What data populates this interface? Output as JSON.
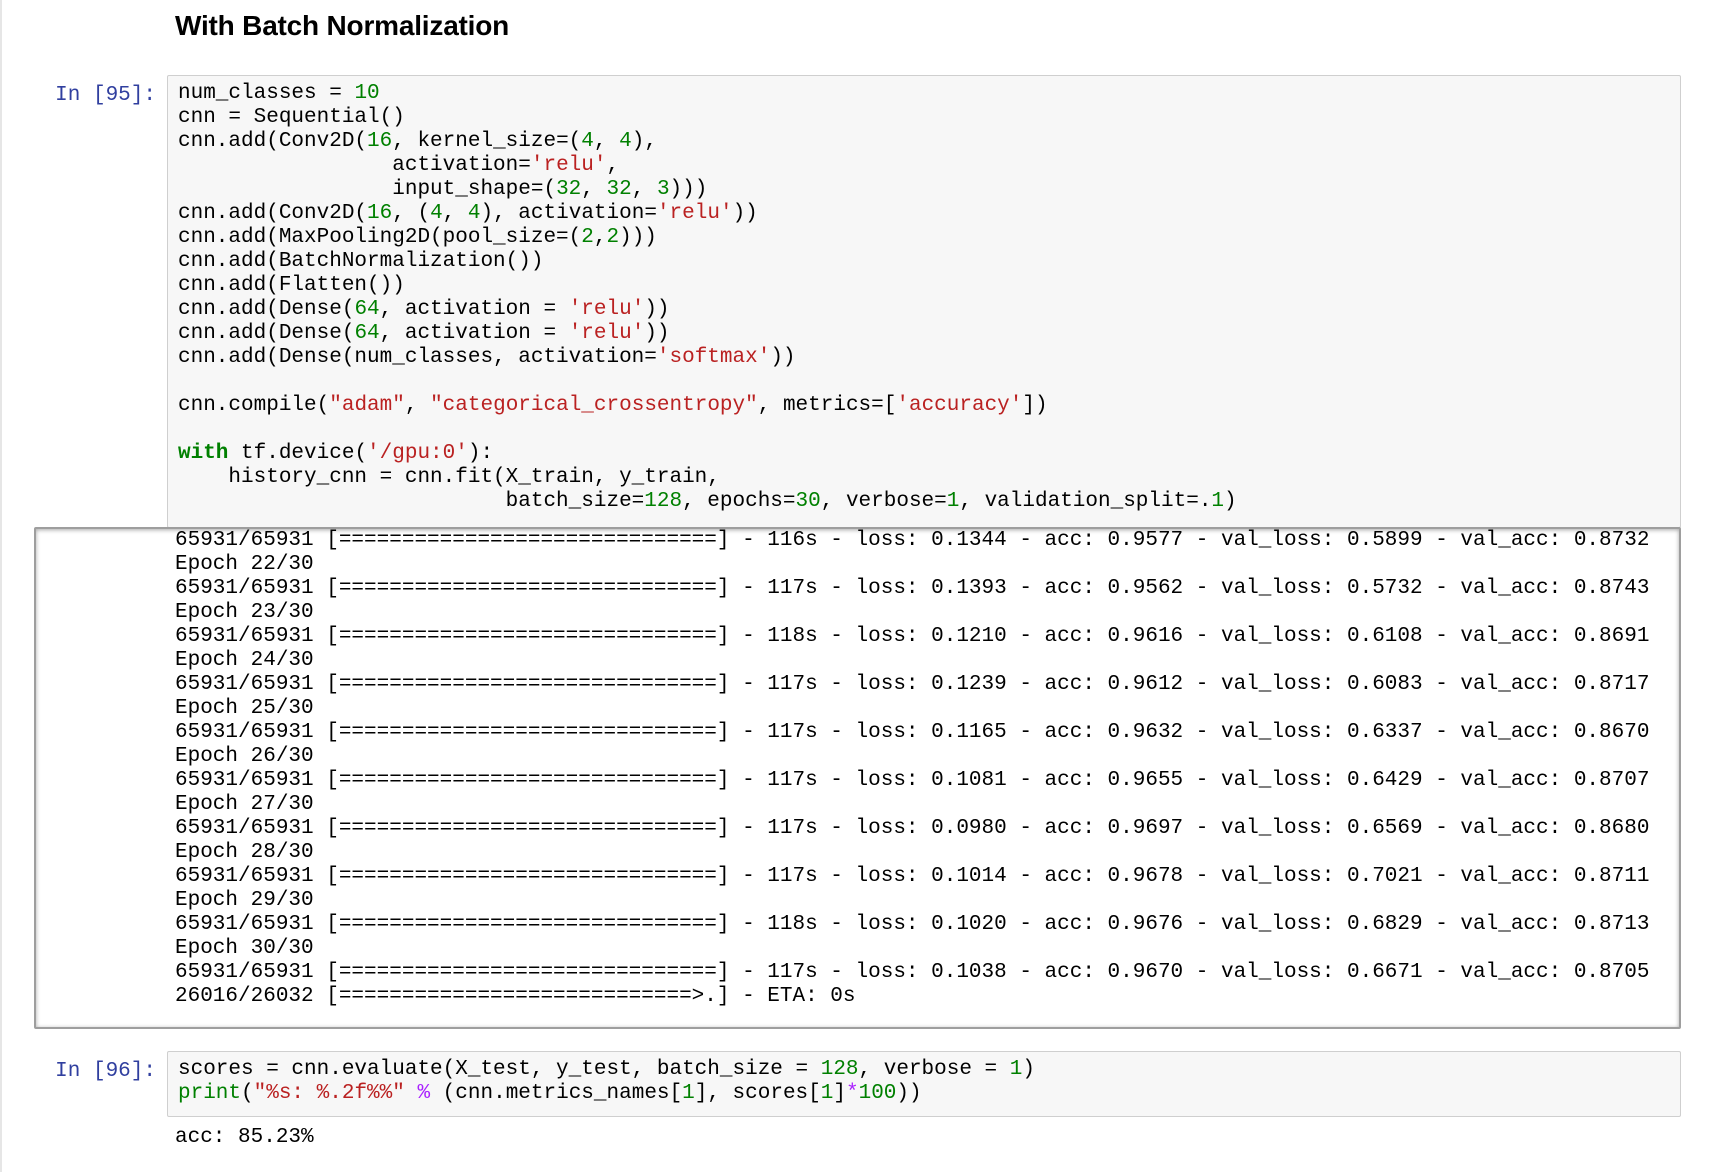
{
  "heading": "With Batch Normalization",
  "cell95": {
    "prompt": "In [95]:",
    "lines": [
      [
        [
          "t",
          "num_classes = "
        ],
        [
          "num",
          "10"
        ]
      ],
      [
        [
          "t",
          "cnn = Sequential()"
        ]
      ],
      [
        [
          "t",
          "cnn.add(Conv2D("
        ],
        [
          "num",
          "16"
        ],
        [
          "t",
          ", kernel_size=("
        ],
        [
          "num",
          "4"
        ],
        [
          "t",
          ", "
        ],
        [
          "num",
          "4"
        ],
        [
          "t",
          "),"
        ]
      ],
      [
        [
          "t",
          "                 activation="
        ],
        [
          "str",
          "'relu'"
        ],
        [
          "t",
          ","
        ]
      ],
      [
        [
          "t",
          "                 input_shape=("
        ],
        [
          "num",
          "32"
        ],
        [
          "t",
          ", "
        ],
        [
          "num",
          "32"
        ],
        [
          "t",
          ", "
        ],
        [
          "num",
          "3"
        ],
        [
          "t",
          ")))"
        ]
      ],
      [
        [
          "t",
          "cnn.add(Conv2D("
        ],
        [
          "num",
          "16"
        ],
        [
          "t",
          ", ("
        ],
        [
          "num",
          "4"
        ],
        [
          "t",
          ", "
        ],
        [
          "num",
          "4"
        ],
        [
          "t",
          "), activation="
        ],
        [
          "str",
          "'relu'"
        ],
        [
          "t",
          "))"
        ]
      ],
      [
        [
          "t",
          "cnn.add(MaxPooling2D(pool_size=("
        ],
        [
          "num",
          "2"
        ],
        [
          "t",
          ","
        ],
        [
          "num",
          "2"
        ],
        [
          "t",
          ")))"
        ]
      ],
      [
        [
          "t",
          "cnn.add(BatchNormalization())"
        ]
      ],
      [
        [
          "t",
          "cnn.add(Flatten())"
        ]
      ],
      [
        [
          "t",
          "cnn.add(Dense("
        ],
        [
          "num",
          "64"
        ],
        [
          "t",
          ", activation = "
        ],
        [
          "str",
          "'relu'"
        ],
        [
          "t",
          "))"
        ]
      ],
      [
        [
          "t",
          "cnn.add(Dense("
        ],
        [
          "num",
          "64"
        ],
        [
          "t",
          ", activation = "
        ],
        [
          "str",
          "'relu'"
        ],
        [
          "t",
          "))"
        ]
      ],
      [
        [
          "t",
          "cnn.add(Dense(num_classes, activation="
        ],
        [
          "str",
          "'softmax'"
        ],
        [
          "t",
          "))"
        ]
      ],
      [
        [
          "t",
          ""
        ]
      ],
      [
        [
          "t",
          "cnn.compile("
        ],
        [
          "str",
          "\"adam\""
        ],
        [
          "t",
          ", "
        ],
        [
          "str",
          "\"categorical_crossentropy\""
        ],
        [
          "t",
          ", metrics=["
        ],
        [
          "str",
          "'accuracy'"
        ],
        [
          "t",
          "])"
        ]
      ],
      [
        [
          "t",
          ""
        ]
      ],
      [
        [
          "kw",
          "with"
        ],
        [
          "t",
          " tf.device("
        ],
        [
          "str",
          "'/gpu:0'"
        ],
        [
          "t",
          "):"
        ]
      ],
      [
        [
          "t",
          "    history_cnn = cnn.fit(X_train, y_train,"
        ]
      ],
      [
        [
          "t",
          "                          batch_size="
        ],
        [
          "num",
          "128"
        ],
        [
          "t",
          ", epochs="
        ],
        [
          "num",
          "30"
        ],
        [
          "t",
          ", verbose="
        ],
        [
          "num",
          "1"
        ],
        [
          "t",
          ", validation_split=."
        ],
        [
          "num",
          "1"
        ],
        [
          "t",
          ")"
        ]
      ]
    ]
  },
  "output": [
    "65931/65931 [==============================] - 116s - loss: 0.1344 - acc: 0.9577 - val_loss: 0.5899 - val_acc: 0.8732",
    "Epoch 22/30",
    "65931/65931 [==============================] - 117s - loss: 0.1393 - acc: 0.9562 - val_loss: 0.5732 - val_acc: 0.8743",
    "Epoch 23/30",
    "65931/65931 [==============================] - 118s - loss: 0.1210 - acc: 0.9616 - val_loss: 0.6108 - val_acc: 0.8691",
    "Epoch 24/30",
    "65931/65931 [==============================] - 117s - loss: 0.1239 - acc: 0.9612 - val_loss: 0.6083 - val_acc: 0.8717",
    "Epoch 25/30",
    "65931/65931 [==============================] - 117s - loss: 0.1165 - acc: 0.9632 - val_loss: 0.6337 - val_acc: 0.8670",
    "Epoch 26/30",
    "65931/65931 [==============================] - 117s - loss: 0.1081 - acc: 0.9655 - val_loss: 0.6429 - val_acc: 0.8707",
    "Epoch 27/30",
    "65931/65931 [==============================] - 117s - loss: 0.0980 - acc: 0.9697 - val_loss: 0.6569 - val_acc: 0.8680",
    "Epoch 28/30",
    "65931/65931 [==============================] - 117s - loss: 0.1014 - acc: 0.9678 - val_loss: 0.7021 - val_acc: 0.8711",
    "Epoch 29/30",
    "65931/65931 [==============================] - 118s - loss: 0.1020 - acc: 0.9676 - val_loss: 0.6829 - val_acc: 0.8713",
    "Epoch 30/30",
    "65931/65931 [==============================] - 117s - loss: 0.1038 - acc: 0.9670 - val_loss: 0.6671 - val_acc: 0.8705",
    "26016/26032 [============================>.] - ETA: 0s"
  ],
  "cell96": {
    "prompt": "In [96]:",
    "lines": [
      [
        [
          "t",
          "scores = cnn.evaluate(X_test, y_test, batch_size = "
        ],
        [
          "num",
          "128"
        ],
        [
          "t",
          ", verbose = "
        ],
        [
          "num",
          "1"
        ],
        [
          "t",
          ")"
        ]
      ],
      [
        [
          "kw2",
          "print"
        ],
        [
          "t",
          "("
        ],
        [
          "str",
          "\"%s: %.2f%%\""
        ],
        [
          "t",
          " "
        ],
        [
          "op",
          "%"
        ],
        [
          "t",
          " (cnn.metrics_names["
        ],
        [
          "num",
          "1"
        ],
        [
          "t",
          "], scores["
        ],
        [
          "num",
          "1"
        ],
        [
          "t",
          "]"
        ],
        [
          "op",
          "*"
        ],
        [
          "num",
          "100"
        ],
        [
          "t",
          "))"
        ]
      ]
    ]
  },
  "result": "acc: 85.23%"
}
